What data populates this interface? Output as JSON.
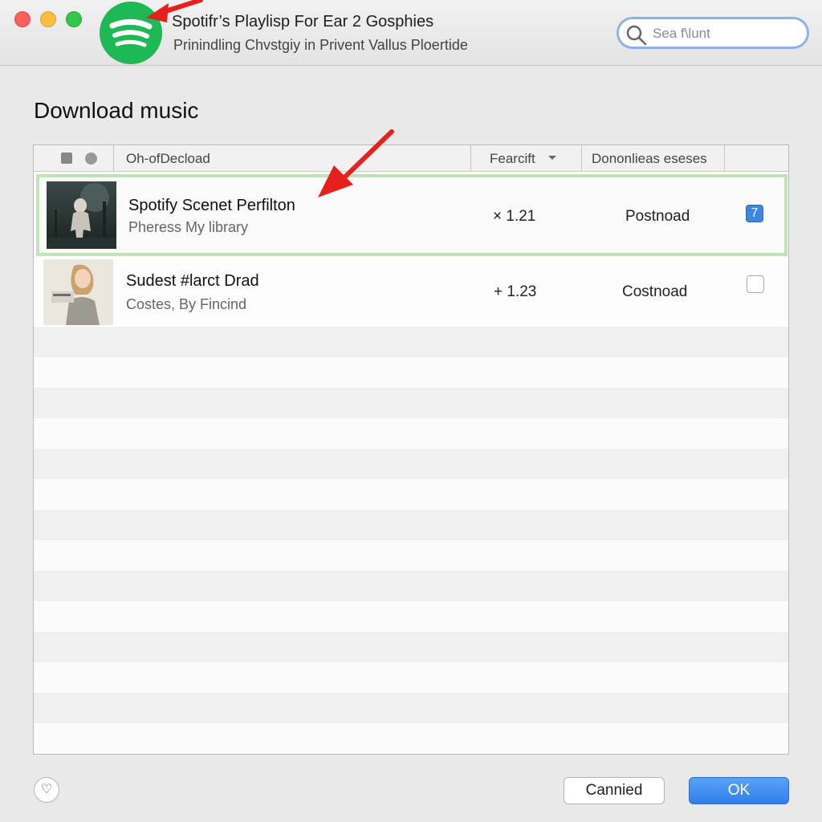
{
  "window": {
    "title": "Spotifr’s Playlisp For Ear 2 Gosphies",
    "subtitle": "Prinindling Chvstgiy in Privent Vallus Ploertide",
    "logo_icon": "spotify-logo-icon",
    "traffic_lights": [
      "close",
      "minimize",
      "maximize"
    ]
  },
  "search": {
    "placeholder": "Sea f\\lunt",
    "icon": "search-icon"
  },
  "dialog": {
    "heading": "Download music"
  },
  "table": {
    "columns": [
      "Oh-ofDecload",
      "Fearcift",
      "Dononlieas eseses"
    ],
    "rows": [
      {
        "title": "Spotify Scenet Perfilton",
        "subtitle": "Pheress My library",
        "value": "× 1.21",
        "status": "Postnoad",
        "checked": true,
        "check_label": "7",
        "highlighted": true
      },
      {
        "title": "Sudest #larct Drad",
        "subtitle": "Costes, By Fincind",
        "value": "+ 1.23",
        "status": "Costnoad",
        "checked": false,
        "check_label": "",
        "highlighted": false
      }
    ]
  },
  "footer": {
    "help_label": "♡",
    "cancel_label": "Cannied",
    "ok_label": "OK"
  },
  "colors": {
    "accent": "#2f7fe9",
    "brand": "#1db954",
    "highlight_border": "#bfe5b4",
    "annotation_arrow": "#e8201c"
  }
}
